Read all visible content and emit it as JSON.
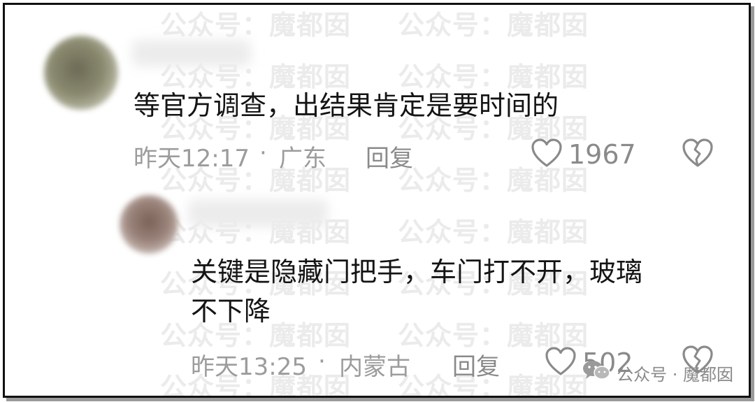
{
  "watermark": "公众号：魔都囡",
  "comments": [
    {
      "text": "等官方调查，出结果肯定是要时间的",
      "time": "昨天12:17",
      "sep": "·",
      "location": "广东",
      "reply_label": "回复",
      "likes": "1967"
    },
    {
      "text": "关键是隐藏门把手，车门打不开，玻璃\n不下降",
      "time": "昨天13:25",
      "sep": "·",
      "location": "内蒙古",
      "reply_label": "回复",
      "likes": "502"
    }
  ],
  "brand": {
    "text": "公众号 · 魔都囡",
    "icon": "wechat-icon"
  },
  "colors": {
    "text": "#141414",
    "meta": "#9c9c9c",
    "icon": "#8a8a8a",
    "watermark": "#ebebeb"
  }
}
